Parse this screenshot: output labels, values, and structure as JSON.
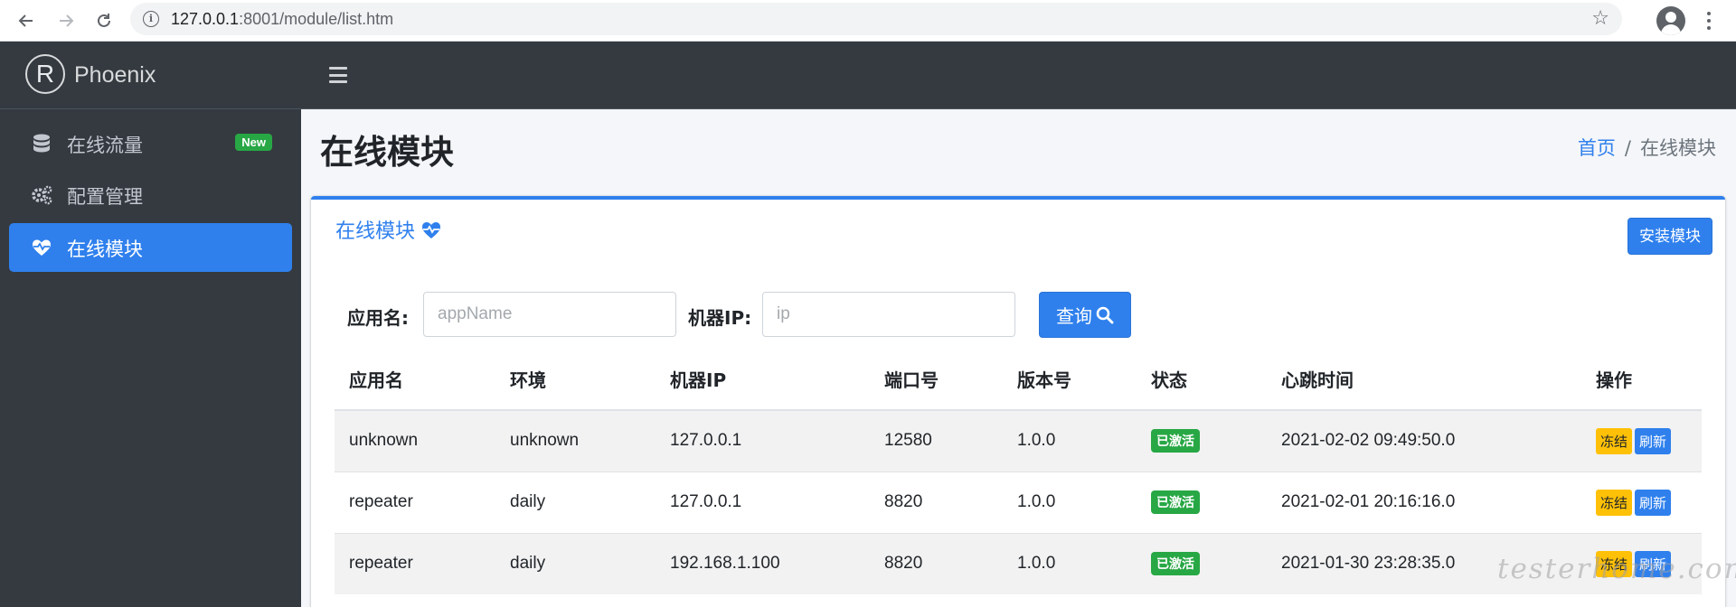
{
  "browser": {
    "url_host": "127.0.0.1",
    "url_rest": ":8001/module/list.htm"
  },
  "brand": {
    "logo_letter": "R",
    "name": "Phoenix"
  },
  "sidebar": {
    "items": [
      {
        "label": "在线流量",
        "icon": "database-icon",
        "badge": "New"
      },
      {
        "label": "配置管理",
        "icon": "cogs-icon"
      },
      {
        "label": "在线模块",
        "icon": "heartbeat-icon",
        "active": true
      }
    ]
  },
  "page": {
    "title": "在线模块",
    "breadcrumb": {
      "home": "首页",
      "separator": "/",
      "current": "在线模块"
    }
  },
  "card": {
    "title": "在线模块",
    "install_label": "安装模块"
  },
  "filters": {
    "app_label": "应用名:",
    "app_placeholder": "appName",
    "ip_label": "机器IP:",
    "ip_placeholder": "ip",
    "query_label": "查询"
  },
  "table": {
    "columns": [
      "应用名",
      "环境",
      "机器IP",
      "端口号",
      "版本号",
      "状态",
      "心跳时间",
      "操作"
    ],
    "rows": [
      {
        "app": "unknown",
        "env": "unknown",
        "ip": "127.0.0.1",
        "port": "12580",
        "version": "1.0.0",
        "status": "已激活",
        "heartbeat": "2021-02-02 09:49:50.0",
        "freeze": "冻结",
        "refresh": "刷新"
      },
      {
        "app": "repeater",
        "env": "daily",
        "ip": "127.0.0.1",
        "port": "8820",
        "version": "1.0.0",
        "status": "已激活",
        "heartbeat": "2021-02-01 20:16:16.0",
        "freeze": "冻结",
        "refresh": "刷新"
      },
      {
        "app": "repeater",
        "env": "daily",
        "ip": "192.168.1.100",
        "port": "8820",
        "version": "1.0.0",
        "status": "已激活",
        "heartbeat": "2021-01-30 23:28:35.0",
        "freeze": "冻结",
        "refresh": "刷新"
      }
    ]
  },
  "watermark": "testerhome.com",
  "colors": {
    "primary": "#2f80ed",
    "success": "#28a745",
    "warning": "#ffc107",
    "sidebar_bg": "#343a40"
  }
}
